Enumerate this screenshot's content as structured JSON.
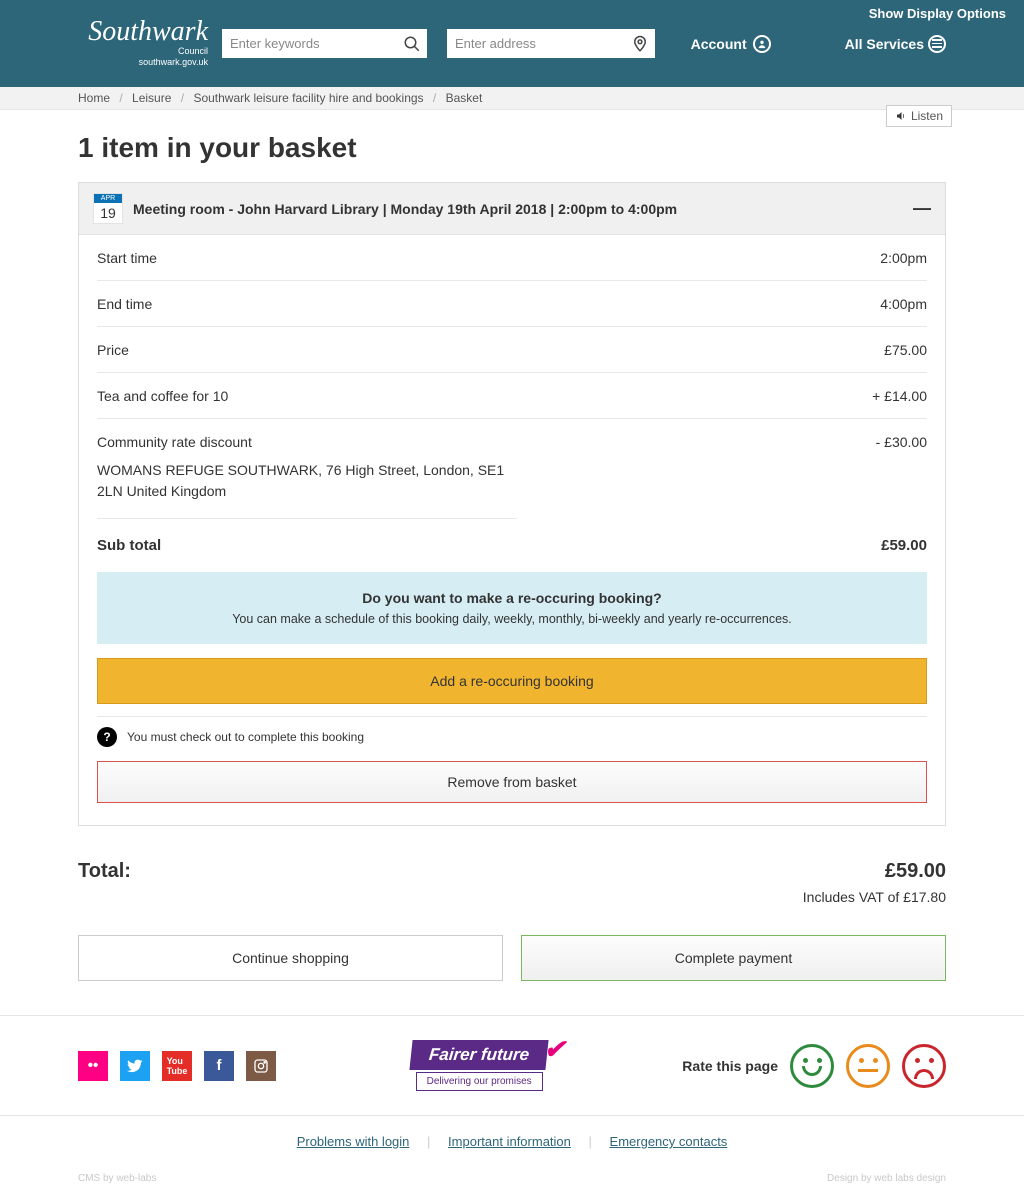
{
  "header": {
    "display_options": "Show Display Options",
    "search_placeholder": "Enter keywords",
    "address_placeholder": "Enter address",
    "account_label": "Account",
    "all_services_label": "All Services"
  },
  "breadcrumb": {
    "items": [
      "Home",
      "Leisure",
      "Southwark leisure facility hire and bookings",
      "Basket"
    ]
  },
  "listen_label": "Listen",
  "page_title": "1 item in your basket",
  "item": {
    "date_badge": {
      "month": "APR",
      "day": "19"
    },
    "title": "Meeting room - John Harvard Library |  Monday 19th April 2018  |  2:00pm to 4:00pm",
    "rows": {
      "start_time_label": "Start time",
      "start_time_value": "2:00pm",
      "end_time_label": "End time",
      "end_time_value": "4:00pm",
      "price_label": "Price",
      "price_value": "£75.00",
      "extra_label": "Tea and coffee for 10",
      "extra_value": "+ £14.00",
      "discount_label": "Community rate discount",
      "discount_value": "- £30.00"
    },
    "address": "WOMANS REFUGE SOUTHWARK, 76 High Street, London, SE1 2LN United Kingdom",
    "subtotal_label": "Sub total",
    "subtotal_value": "£59.00",
    "recurring_question": "Do you want to make a re-occuring booking?",
    "recurring_description": "You can make a schedule of this booking daily, weekly, monthly, bi-weekly and yearly re-occurrences.",
    "add_recurring_btn": "Add a re-occuring booking",
    "checkout_note": "You must check out to complete this booking",
    "remove_btn": "Remove from basket"
  },
  "totals": {
    "label": "Total:",
    "value": "£59.00",
    "vat": "Includes VAT of £17.80"
  },
  "actions": {
    "continue": "Continue shopping",
    "complete": "Complete payment"
  },
  "footer": {
    "fairer_title": "Fairer future",
    "fairer_sub": "Delivering our promises",
    "rate_label": "Rate this page",
    "links": [
      "Problems with login",
      "Important information",
      "Emergency contacts"
    ],
    "credit_left": "CMS by web-labs",
    "credit_right": "Design by web labs design"
  }
}
